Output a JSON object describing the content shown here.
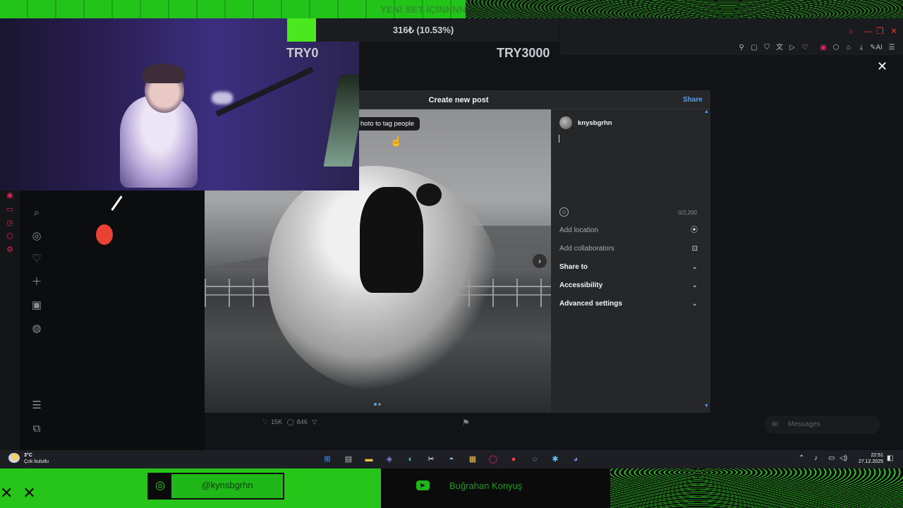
{
  "stream": {
    "goal_title": "YENİ SET İÇİNNNN",
    "goal_progress_text": "316₺ (10.53%)",
    "goal_progress_fraction": 0.1053,
    "goal_min": "TRY0",
    "goal_max": "TRY3000",
    "instagram_handle": "@kynsbgrhn",
    "youtube_name": "Buğrahan Konyuş",
    "accent_color": "#2cd41f"
  },
  "modal": {
    "title": "Create new post",
    "share_label": "Share",
    "tag_tooltip": "hoto to tag people",
    "username": "knysbgrhn",
    "caption_value": "",
    "char_counter": "0/2,200",
    "rows": [
      {
        "label": "Add location",
        "icon": "location-pin-icon"
      },
      {
        "label": "Add collaborators",
        "icon": "person-add-icon"
      },
      {
        "label": "Share to",
        "icon": "chevron-down-icon"
      },
      {
        "label": "Accessibility",
        "icon": "chevron-down-icon"
      },
      {
        "label": "Advanced settings",
        "icon": "chevron-down-icon"
      }
    ]
  },
  "post": {
    "likes": "15K",
    "comments": "846"
  },
  "messages": {
    "label": "Messages"
  },
  "taskbar": {
    "weather_temp": "3°C",
    "weather_desc": "Çok bulutlu",
    "time": "22:51",
    "date": "27.12.2025"
  }
}
